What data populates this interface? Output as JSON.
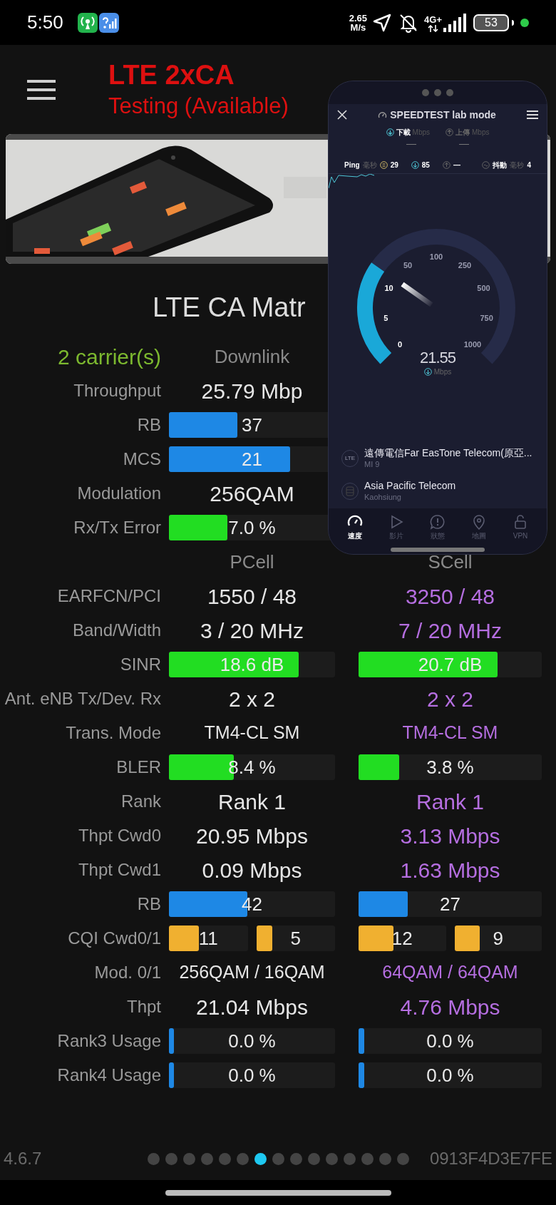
{
  "status_bar": {
    "time": "5:50",
    "speed_value": "2.65",
    "speed_unit": "M/s",
    "network": "4G+",
    "battery": "53"
  },
  "app_bar": {
    "title": "LTE 2xCA",
    "subtitle": "Testing (Available)"
  },
  "section_title": "LTE CA Matr",
  "rows": [
    {
      "kind": "head",
      "label": "2 carrier(s)",
      "cells": [
        {
          "text": "Downlink"
        }
      ]
    },
    {
      "kind": "big",
      "label": "Throughput",
      "cells": [
        {
          "text": "25.79 Mbp"
        }
      ]
    },
    {
      "kind": "bar",
      "label": "RB",
      "color": "#1e88e5",
      "cells": [
        {
          "text": "37",
          "level": 0.41
        }
      ]
    },
    {
      "kind": "bar",
      "label": "MCS",
      "color": "#1e88e5",
      "cells": [
        {
          "text": "21",
          "level": 0.73
        }
      ]
    },
    {
      "kind": "big",
      "label": "Modulation",
      "cells": [
        {
          "text": "256QAM"
        }
      ]
    },
    {
      "kind": "bar",
      "label": "Rx/Tx Error",
      "color": "#22dd22",
      "cells": [
        {
          "text": "7.0 %",
          "level": 0.35
        }
      ]
    },
    {
      "kind": "head",
      "cells": [
        {
          "text": "PCell"
        },
        {
          "text": "SCell"
        }
      ]
    },
    {
      "kind": "big",
      "label": "EARFCN/PCI",
      "cells": [
        {
          "text": "1550 / 48"
        },
        {
          "text": "3250 / 48"
        }
      ]
    },
    {
      "kind": "big",
      "label": "Band/Width",
      "cells": [
        {
          "text": "3 / 20 MHz"
        },
        {
          "text": "7 / 20 MHz"
        }
      ]
    },
    {
      "kind": "bar",
      "label": "SINR",
      "color": "#22dd22",
      "cells": [
        {
          "text": "18.6 dB",
          "level": 0.78
        },
        {
          "text": "20.7 dB",
          "level": 0.76
        }
      ]
    },
    {
      "kind": "big",
      "label": "Ant. eNB Tx/Dev. Rx",
      "cells": [
        {
          "text": "2 x 2"
        },
        {
          "text": "2 x 2"
        }
      ]
    },
    {
      "kind": "small",
      "label": "Trans. Mode",
      "cells": [
        {
          "text": "TM4-CL SM"
        },
        {
          "text": "TM4-CL SM"
        }
      ]
    },
    {
      "kind": "bar",
      "label": "BLER",
      "color": "#22dd22",
      "cells": [
        {
          "text": "8.4 %",
          "level": 0.39
        },
        {
          "text": "3.8 %",
          "level": 0.22
        }
      ]
    },
    {
      "kind": "big",
      "label": "Rank",
      "cells": [
        {
          "text": "Rank 1"
        },
        {
          "text": "Rank 1"
        }
      ]
    },
    {
      "kind": "big",
      "label": "Thpt Cwd0",
      "cells": [
        {
          "text": "20.95 Mbps"
        },
        {
          "text": "3.13 Mbps"
        }
      ]
    },
    {
      "kind": "big",
      "label": "Thpt Cwd1",
      "cells": [
        {
          "text": "0.09 Mbps"
        },
        {
          "text": "1.63 Mbps"
        }
      ]
    },
    {
      "kind": "bar",
      "label": "RB",
      "color": "#1e88e5",
      "cells": [
        {
          "text": "42",
          "level": 0.47
        },
        {
          "text": "27",
          "level": 0.27
        }
      ]
    },
    {
      "kind": "dual",
      "label": "CQI Cwd0/1",
      "color": "#f0b030",
      "cells": [
        {
          "bars": [
            {
              "text": "11",
              "level": 0.38
            },
            {
              "text": "5",
              "level": 0.2
            }
          ]
        },
        {
          "bars": [
            {
              "text": "12",
              "level": 0.4
            },
            {
              "text": "9",
              "level": 0.29
            }
          ]
        }
      ]
    },
    {
      "kind": "small",
      "label": "Mod. 0/1",
      "cells": [
        {
          "text": "256QAM / 16QAM"
        },
        {
          "text": "64QAM / 64QAM"
        }
      ]
    },
    {
      "kind": "big",
      "label": "Thpt",
      "cells": [
        {
          "text": "21.04 Mbps"
        },
        {
          "text": "4.76 Mbps"
        }
      ]
    },
    {
      "kind": "bar",
      "label": "Rank3 Usage",
      "color": "#1e88e5",
      "cells": [
        {
          "text": "0.0 %",
          "level": 0.03
        },
        {
          "text": "0.0 %",
          "level": 0.03
        }
      ]
    },
    {
      "kind": "bar",
      "label": "Rank4 Usage",
      "color": "#1e88e5",
      "cells": [
        {
          "text": "0.0 %",
          "level": 0.03
        },
        {
          "text": "0.0 %",
          "level": 0.03
        }
      ]
    }
  ],
  "footer": {
    "version": "4.6.7",
    "pages": [
      {
        "selected": false
      },
      {
        "selected": false
      },
      {
        "selected": false
      },
      {
        "selected": false
      },
      {
        "selected": false
      },
      {
        "selected": false
      },
      {
        "selected": true
      },
      {
        "selected": false
      },
      {
        "selected": false
      },
      {
        "selected": false
      },
      {
        "selected": false
      },
      {
        "selected": false
      },
      {
        "selected": false
      },
      {
        "selected": false
      },
      {
        "selected": false
      }
    ],
    "device_id": "0913F4D3E7FE"
  },
  "speedtest": {
    "title": "SPEEDTEST lab mode",
    "metrics": [
      {
        "kind": "download",
        "label": "下載",
        "unit": "Mbps",
        "value": "—",
        "selected": true
      },
      {
        "kind": "upload",
        "label": "上傳",
        "unit": "Mbps",
        "value": "—",
        "selected": false
      }
    ],
    "ping": {
      "label": "Ping",
      "unit": "毫秒",
      "idle": "29",
      "download": "85",
      "upload": "—"
    },
    "jitter": {
      "label": "抖動",
      "unit": "毫秒",
      "value": "4"
    },
    "gauge": {
      "ticks": [
        "0",
        "5",
        "10",
        "50",
        "100",
        "250",
        "500",
        "750",
        "1000"
      ],
      "speed": "21.55",
      "unit": "Mbps"
    },
    "servers": [
      {
        "kind": "carrier",
        "badge": "LTE",
        "name": "遠傳電信Far EasTone Telecom(原亞...",
        "detail": "MI 9"
      },
      {
        "kind": "server",
        "name": "Asia Pacific Telecom",
        "detail": "Kaohsiung"
      }
    ],
    "tabs": [
      {
        "kind": "speed",
        "label": "速度",
        "selected": true
      },
      {
        "kind": "video",
        "label": "影片",
        "selected": false
      },
      {
        "kind": "status",
        "label": "狀態",
        "selected": false
      },
      {
        "kind": "map",
        "label": "地圖",
        "selected": false
      },
      {
        "kind": "vpn",
        "label": "VPN",
        "selected": false
      }
    ]
  }
}
